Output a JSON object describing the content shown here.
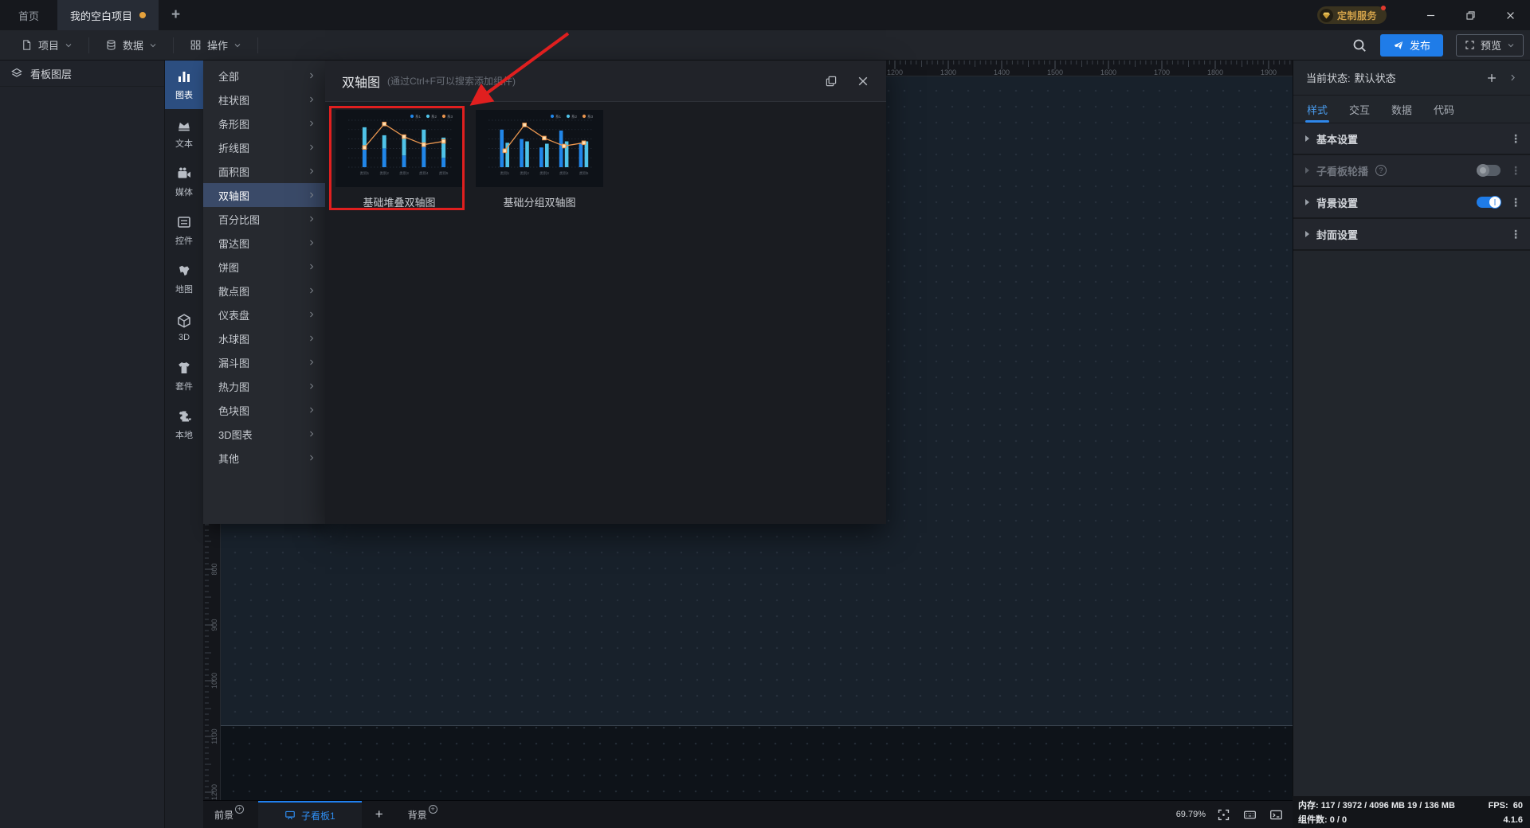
{
  "titlebar": {
    "home_tab": "首页",
    "project_tab": "我的空白项目",
    "badge": "定制服务"
  },
  "menubar": {
    "items": [
      {
        "key": "project",
        "label": "项目",
        "icon": "doc"
      },
      {
        "key": "data",
        "label": "数据",
        "icon": "db"
      },
      {
        "key": "action",
        "label": "操作",
        "icon": "grid"
      }
    ],
    "publish_label": "发布",
    "preview_label": "预览"
  },
  "layers_panel": {
    "title": "看板图层"
  },
  "sidebar": {
    "items": [
      {
        "key": "chart",
        "label": "图表",
        "icon": "chart",
        "active": true
      },
      {
        "key": "text",
        "label": "文本",
        "icon": "text"
      },
      {
        "key": "media",
        "label": "媒体",
        "icon": "media"
      },
      {
        "key": "widget",
        "label": "控件",
        "icon": "widget"
      },
      {
        "key": "map",
        "label": "地图",
        "icon": "map"
      },
      {
        "key": "threed",
        "label": "3D",
        "icon": "threed"
      },
      {
        "key": "suite",
        "label": "套件",
        "icon": "suite"
      },
      {
        "key": "local",
        "label": "本地",
        "icon": "local"
      }
    ]
  },
  "categories": {
    "items": [
      "全部",
      "柱状图",
      "条形图",
      "折线图",
      "面积图",
      "双轴图",
      "百分比图",
      "雷达图",
      "饼图",
      "散点图",
      "仪表盘",
      "水球图",
      "漏斗图",
      "热力图",
      "色块图",
      "3D图表",
      "其他"
    ],
    "selected": "双轴图"
  },
  "dialog": {
    "title": "双轴图",
    "hint": "(通过Ctrl+F可以搜索添加组件)",
    "cards": [
      {
        "label": "基础堆叠双轴图",
        "type": "stacked",
        "selected": true,
        "chart": {
          "categories": [
            "类别1",
            "类别2",
            "类别3",
            "类别4",
            "类别5"
          ],
          "legend": [
            {
              "label": "系1",
              "color": "#2186e8"
            },
            {
              "label": "系2",
              "color": "#4fc3e8"
            },
            {
              "label": "系3",
              "color": "#e8954f"
            }
          ],
          "series": [
            {
              "name": "系1",
              "values": [
                0.42,
                0.4,
                0.25,
                0.45,
                0.2
              ]
            },
            {
              "name": "系2",
              "values": [
                0.43,
                0.28,
                0.37,
                0.35,
                0.43
              ]
            }
          ],
          "line": {
            "name": "系3",
            "values": [
              0.42,
              0.92,
              0.65,
              0.48,
              0.55
            ]
          }
        }
      },
      {
        "label": "基础分组双轴图",
        "type": "grouped",
        "selected": false,
        "chart": {
          "categories": [
            "类别1",
            "类别2",
            "类别3",
            "类别4",
            "类别5"
          ],
          "legend": [
            {
              "label": "系1",
              "color": "#2186e8"
            },
            {
              "label": "系2",
              "color": "#4fc3e8"
            },
            {
              "label": "系3",
              "color": "#e8954f"
            }
          ],
          "series": [
            {
              "name": "系1",
              "values": [
                0.8,
                0.6,
                0.42,
                0.78,
                0.52
              ]
            },
            {
              "name": "系2",
              "values": [
                0.52,
                0.55,
                0.5,
                0.55,
                0.55
              ]
            }
          ],
          "line": {
            "name": "系3",
            "values": [
              0.35,
              0.9,
              0.62,
              0.45,
              0.52
            ]
          }
        }
      }
    ]
  },
  "ruler": {
    "h_values": [
      1200,
      1300,
      1400,
      1500,
      1600,
      1700,
      1800,
      1900
    ],
    "v_values": [
      800,
      900,
      1000,
      1100,
      1200
    ]
  },
  "right_panel": {
    "status_label": "当前状态:",
    "status_value": "默认状态",
    "tabs": [
      {
        "label": "样式",
        "active": true
      },
      {
        "label": "交互",
        "active": false
      },
      {
        "label": "数据",
        "active": false
      },
      {
        "label": "代码",
        "active": false
      }
    ],
    "sections": [
      {
        "label": "基本设置",
        "toggle": null,
        "disabled": false,
        "help": false
      },
      {
        "label": "子看板轮播",
        "toggle": "off",
        "disabled": true,
        "help": true
      },
      {
        "label": "背景设置",
        "toggle": "on",
        "disabled": false,
        "help": false
      },
      {
        "label": "封面设置",
        "toggle": null,
        "disabled": false,
        "help": false
      }
    ]
  },
  "bottombar": {
    "foreground": "前景",
    "subboard_tab": "子看板1",
    "background": "背景",
    "zoom": "69.79%"
  },
  "statusbar": {
    "memory_label": "内存:",
    "memory_value": "117 / 3972 / 4096 MB  19 / 136 MB",
    "fps_label": "FPS:",
    "fps_value": "60",
    "components_label": "组件数:",
    "components_value": "0 / 0",
    "version": "4.1.6"
  },
  "colors": {
    "accent": "#1f7ce8",
    "orange_dot": "#e6a23c",
    "annotation_red": "#e01f1f",
    "bar1": "#2186e8",
    "bar2": "#4fc3e8",
    "line": "#e8954f"
  }
}
